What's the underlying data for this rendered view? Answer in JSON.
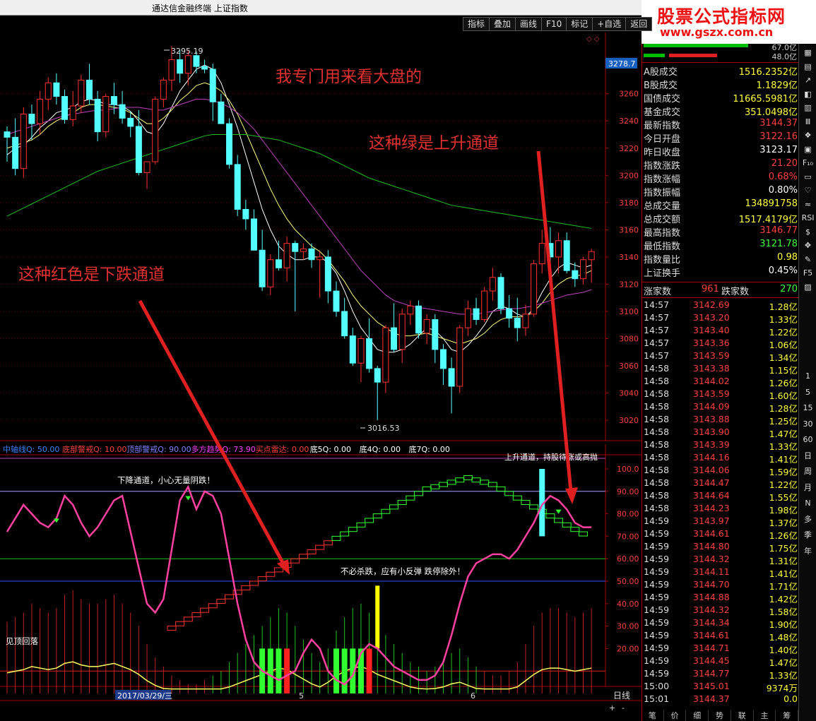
{
  "window": {
    "title": "通达信金融终端    上证指数"
  },
  "watermark": {
    "line1": "股票公式指标网",
    "line2": "www.gszx.com.cn",
    "logo": "G"
  },
  "toolbar": [
    "指标",
    "叠加",
    "画线",
    "F10",
    "标记",
    "+自选",
    "返回"
  ],
  "price_axis": {
    "current_tag": "3278.7",
    "ticks": [
      "3260",
      "3240",
      "3220",
      "3200",
      "3180",
      "3160",
      "3140",
      "3120",
      "3100",
      "3080",
      "3060",
      "3040",
      "3020"
    ]
  },
  "indicator_axis": {
    "ticks": [
      "100.0",
      "90.00",
      "80.00",
      "70.00",
      "60.00",
      "50.00",
      "40.00",
      "30.00",
      "20.00"
    ]
  },
  "indicator_header": [
    {
      "text": "中轴线Q: 50.00",
      "color": "#4080ff"
    },
    {
      "text": "底部警戒Q: 10.00",
      "color": "#ff4040"
    },
    {
      "text": "顶部警戒Q: 90.00",
      "color": "#8080ff"
    },
    {
      "text": "多方趋势Q: 73.90",
      "color": "#ff40ff"
    },
    {
      "text": "买点雷达: 0.00",
      "color": "#ff4040"
    },
    {
      "text": "底5Q: 0.00",
      "color": "#ffffff"
    },
    {
      "text": "底4Q: 0.00",
      "color": "#ffffff"
    },
    {
      "text": "底7Q: 0.00",
      "color": "#ffffff"
    }
  ],
  "annotations": {
    "top": "我专门用来看大盘的",
    "green": "这种绿是上升通道",
    "red": "这种红色是下跌通道",
    "high_label": "3295.19",
    "low_label": "3016.53",
    "down_channel": "下降通道，小心无量阴跌！",
    "no_kill": "不必杀跌，应有小反弹 跌停除外！",
    "top_fall": "见顶回落",
    "up_channel_cut": "上升通道，持股待涨或高抛"
  },
  "date_axis": {
    "date": "2017/03/29/三",
    "m5": "5",
    "m6": "6",
    "period": "日线"
  },
  "chart_data": {
    "type": "candlestick",
    "title": "上证指数",
    "ylim": [
      3005,
      3305
    ],
    "high": 3295.19,
    "low": 3016.53,
    "candles": [
      [
        3232,
        3236,
        3210,
        3228
      ],
      [
        3228,
        3242,
        3200,
        3205
      ],
      [
        3205,
        3250,
        3198,
        3245
      ],
      [
        3245,
        3252,
        3226,
        3238
      ],
      [
        3238,
        3262,
        3230,
        3256
      ],
      [
        3256,
        3272,
        3248,
        3268
      ],
      [
        3268,
        3275,
        3252,
        3258
      ],
      [
        3258,
        3263,
        3238,
        3241
      ],
      [
        3241,
        3262,
        3236,
        3251
      ],
      [
        3251,
        3274,
        3246,
        3270
      ],
      [
        3270,
        3282,
        3252,
        3256
      ],
      [
        3256,
        3262,
        3225,
        3232
      ],
      [
        3232,
        3260,
        3228,
        3258
      ],
      [
        3258,
        3268,
        3245,
        3252
      ],
      [
        3252,
        3262,
        3238,
        3242
      ],
      [
        3242,
        3247,
        3228,
        3236
      ],
      [
        3236,
        3248,
        3200,
        3202
      ],
      [
        3202,
        3210,
        3190,
        3210
      ],
      [
        3210,
        3258,
        3208,
        3256
      ],
      [
        3256,
        3272,
        3250,
        3270
      ],
      [
        3270,
        3295,
        3262,
        3285
      ],
      [
        3285,
        3292,
        3268,
        3275
      ],
      [
        3275,
        3292,
        3266,
        3288
      ],
      [
        3288,
        3291,
        3275,
        3280
      ],
      [
        3280,
        3285,
        3275,
        3278
      ],
      [
        3278,
        3282,
        3240,
        3254
      ],
      [
        3254,
        3260,
        3242,
        3238
      ],
      [
        3238,
        3242,
        3205,
        3208
      ],
      [
        3208,
        3215,
        3170,
        3175
      ],
      [
        3175,
        3182,
        3160,
        3168
      ],
      [
        3168,
        3175,
        3150,
        3145
      ],
      [
        3145,
        3160,
        3115,
        3118
      ],
      [
        3118,
        3142,
        3112,
        3138
      ],
      [
        3138,
        3152,
        3130,
        3132
      ],
      [
        3132,
        3155,
        3122,
        3150
      ],
      [
        3150,
        3152,
        3100,
        3144
      ],
      [
        3144,
        3150,
        3138,
        3146
      ],
      [
        3146,
        3150,
        3132,
        3138
      ],
      [
        3138,
        3144,
        3110,
        3140
      ],
      [
        3140,
        3145,
        3106,
        3115
      ],
      [
        3115,
        3122,
        3096,
        3100
      ],
      [
        3100,
        3110,
        3080,
        3082
      ],
      [
        3082,
        3088,
        3060,
        3062
      ],
      [
        3062,
        3082,
        3048,
        3080
      ],
      [
        3080,
        3095,
        3055,
        3058
      ],
      [
        3058,
        3060,
        3020,
        3048
      ],
      [
        3048,
        3090,
        3040,
        3088
      ],
      [
        3088,
        3106,
        3070,
        3072
      ],
      [
        3072,
        3102,
        3062,
        3098
      ],
      [
        3098,
        3108,
        3090,
        3104
      ],
      [
        3104,
        3108,
        3080,
        3084
      ],
      [
        3084,
        3098,
        3076,
        3094
      ],
      [
        3094,
        3098,
        3062,
        3072
      ],
      [
        3072,
        3076,
        3046,
        3058
      ],
      [
        3058,
        3066,
        3025,
        3045
      ],
      [
        3045,
        3090,
        3040,
        3088
      ],
      [
        3088,
        3108,
        3082,
        3102
      ],
      [
        3102,
        3110,
        3090,
        3094
      ],
      [
        3094,
        3118,
        3092,
        3115
      ],
      [
        3115,
        3132,
        3108,
        3125
      ],
      [
        3125,
        3128,
        3098,
        3102
      ],
      [
        3102,
        3112,
        3088,
        3095
      ],
      [
        3095,
        3110,
        3078,
        3088
      ],
      [
        3088,
        3105,
        3082,
        3098
      ],
      [
        3098,
        3138,
        3096,
        3135
      ],
      [
        3135,
        3160,
        3128,
        3150
      ],
      [
        3150,
        3162,
        3136,
        3140
      ],
      [
        3140,
        3158,
        3128,
        3152
      ],
      [
        3152,
        3158,
        3128,
        3130
      ],
      [
        3130,
        3136,
        3118,
        3124
      ],
      [
        3124,
        3140,
        3120,
        3138
      ],
      [
        3138,
        3146,
        3121,
        3144
      ]
    ],
    "ma_lines": [
      {
        "color": "#ffffff",
        "values": [
          3215,
          3220,
          3222,
          3228,
          3235,
          3240,
          3246,
          3248,
          3250,
          3254,
          3256,
          3255,
          3252,
          3252,
          3251,
          3247,
          3240,
          3232,
          3230,
          3238,
          3250,
          3262,
          3270,
          3278,
          3281,
          3278,
          3268,
          3252,
          3235,
          3215,
          3195,
          3175,
          3160,
          3148,
          3142,
          3138,
          3138,
          3140,
          3140,
          3136,
          3128,
          3115,
          3100,
          3088,
          3080,
          3072,
          3070,
          3070,
          3072,
          3076,
          3082,
          3088,
          3086,
          3080,
          3072,
          3070,
          3075,
          3082,
          3090,
          3100,
          3104,
          3102,
          3098,
          3096,
          3102,
          3114,
          3124,
          3132,
          3136,
          3134,
          3132,
          3134
        ]
      },
      {
        "color": "#ffff80",
        "values": [
          3220,
          3222,
          3224,
          3226,
          3230,
          3236,
          3240,
          3243,
          3246,
          3250,
          3252,
          3252,
          3251,
          3250,
          3249,
          3246,
          3242,
          3238,
          3238,
          3242,
          3248,
          3255,
          3260,
          3266,
          3268,
          3266,
          3262,
          3255,
          3245,
          3232,
          3218,
          3204,
          3190,
          3178,
          3168,
          3160,
          3154,
          3148,
          3144,
          3138,
          3130,
          3122,
          3112,
          3104,
          3098,
          3092,
          3088,
          3084,
          3082,
          3082,
          3083,
          3084,
          3082,
          3080,
          3078,
          3076,
          3078,
          3080,
          3084,
          3090,
          3094,
          3096,
          3096,
          3096,
          3100,
          3106,
          3114,
          3120,
          3124,
          3126,
          3127,
          3130
        ]
      },
      {
        "color": "#c040c0",
        "values": [
          3230,
          3232,
          3234,
          3236,
          3238,
          3240,
          3242,
          3244,
          3245,
          3246,
          3247,
          3248,
          3248,
          3249,
          3250,
          3250,
          3250,
          3249,
          3248,
          3248,
          3250,
          3252,
          3254,
          3256,
          3256,
          3255,
          3253,
          3250,
          3246,
          3240,
          3234,
          3226,
          3218,
          3210,
          3202,
          3194,
          3186,
          3178,
          3170,
          3162,
          3154,
          3146,
          3138,
          3130,
          3124,
          3118,
          3112,
          3108,
          3106,
          3104,
          3103,
          3102,
          3101,
          3100,
          3099,
          3098,
          3098,
          3098,
          3099,
          3100,
          3101,
          3102,
          3102,
          3103,
          3104,
          3106,
          3108,
          3110,
          3112,
          3113,
          3114,
          3116
        ]
      },
      {
        "color": "#20c020",
        "values": [
          3170,
          3173,
          3176,
          3179,
          3182,
          3185,
          3188,
          3191,
          3194,
          3197,
          3200,
          3203,
          3205,
          3207,
          3209,
          3211,
          3213,
          3215,
          3217,
          3219,
          3221,
          3223,
          3225,
          3227,
          3229,
          3230,
          3230,
          3230,
          3230,
          3230,
          3229,
          3228,
          3227,
          3226,
          3224,
          3222,
          3220,
          3218,
          3216,
          3213,
          3210,
          3207,
          3204,
          3201,
          3198,
          3196,
          3194,
          3192,
          3190,
          3188,
          3186,
          3184,
          3182,
          3180,
          3178,
          3177,
          3176,
          3175,
          3174,
          3173,
          3172,
          3171,
          3170,
          3169,
          3168,
          3167,
          3166,
          3165,
          3164,
          3163,
          3162,
          3161
        ]
      }
    ],
    "indicator": {
      "ylim": [
        0,
        100
      ],
      "trend_line": [
        72,
        78,
        84,
        80,
        76,
        74,
        78,
        88,
        84,
        76,
        70,
        74,
        80,
        86,
        88,
        72,
        56,
        40,
        36,
        42,
        64,
        86,
        92,
        82,
        90,
        88,
        80,
        60,
        40,
        24,
        14,
        10,
        8,
        6,
        8,
        10,
        18,
        24,
        20,
        10,
        6,
        4,
        8,
        18,
        22,
        20,
        16,
        12,
        10,
        8,
        6,
        6,
        8,
        14,
        26,
        40,
        52,
        58,
        60,
        62,
        62,
        60,
        64,
        70,
        76,
        84,
        88,
        86,
        82,
        76,
        74,
        74
      ],
      "stair": [
        28,
        30,
        32,
        34,
        36,
        38,
        40,
        42,
        44,
        46,
        48,
        50,
        52,
        54,
        56,
        58,
        60,
        62,
        64,
        66,
        68,
        70,
        72,
        74,
        76,
        78,
        80,
        82,
        84,
        86,
        88,
        90,
        91,
        92,
        93,
        94,
        95,
        94,
        93,
        92,
        90,
        88,
        86,
        84,
        82,
        80,
        78,
        76,
        74,
        72,
        70
      ]
    }
  },
  "quote_panel": {
    "top_bars": {
      "a": "67.0亿",
      "b": "48.0亿"
    },
    "rows": [
      {
        "label": "A股成交",
        "value": "1516.2352亿",
        "color": "#ffff40"
      },
      {
        "label": "B股成交",
        "value": "1.1829亿",
        "color": "#ffff40"
      },
      {
        "label": "国债成交",
        "value": "11665.5981亿",
        "color": "#ffff40"
      },
      {
        "label": "基金成交",
        "value": "351.0498亿",
        "color": "#ffff40"
      },
      {
        "label": "最新指数",
        "value": "3144.37",
        "color": "#ff4040"
      },
      {
        "label": "今日开盘",
        "value": "3122.16",
        "color": "#ff4040"
      },
      {
        "label": "昨日收盘",
        "value": "3123.17",
        "color": "#ffffff"
      },
      {
        "label": "指数涨跌",
        "value": "21.20",
        "color": "#ff4040"
      },
      {
        "label": "指数涨幅",
        "value": "0.68%",
        "color": "#ff4040"
      },
      {
        "label": "指数振幅",
        "value": "0.80%",
        "color": "#ffffff"
      },
      {
        "label": "总成交量",
        "value": "134891758",
        "color": "#ffff40"
      },
      {
        "label": "总成交额",
        "value": "1517.4179亿",
        "color": "#ffff40"
      },
      {
        "label": "最高指数",
        "value": "3146.77",
        "color": "#ff4040"
      },
      {
        "label": "最低指数",
        "value": "3121.78",
        "color": "#40ff40"
      },
      {
        "label": "指数量比",
        "value": "0.98",
        "color": "#ffff40"
      },
      {
        "label": "上证换手",
        "value": "0.45%",
        "color": "#ffffff"
      }
    ],
    "advance": {
      "up_label": "涨家数",
      "up": "961",
      "down_label": "跌家数",
      "down": "270"
    },
    "ticks": [
      {
        "t": "14:57",
        "p": "3142.69",
        "v": "1.28亿"
      },
      {
        "t": "14:57",
        "p": "3143.20",
        "v": "1.33亿"
      },
      {
        "t": "14:57",
        "p": "3143.40",
        "v": "1.22亿"
      },
      {
        "t": "14:57",
        "p": "3143.36",
        "v": "1.06亿"
      },
      {
        "t": "14:57",
        "p": "3143.59",
        "v": "1.34亿"
      },
      {
        "t": "14:58",
        "p": "3143.38",
        "v": "1.15亿"
      },
      {
        "t": "14:58",
        "p": "3144.02",
        "v": "1.26亿"
      },
      {
        "t": "14:58",
        "p": "3143.59",
        "v": "1.60亿"
      },
      {
        "t": "14:58",
        "p": "3144.09",
        "v": "1.28亿"
      },
      {
        "t": "14:58",
        "p": "3143.88",
        "v": "1.25亿"
      },
      {
        "t": "14:58",
        "p": "3143.90",
        "v": "1.47亿"
      },
      {
        "t": "14:58",
        "p": "3143.39",
        "v": "1.33亿"
      },
      {
        "t": "14:58",
        "p": "3144.16",
        "v": "1.41亿"
      },
      {
        "t": "14:58",
        "p": "3144.06",
        "v": "1.59亿"
      },
      {
        "t": "14:58",
        "p": "3144.47",
        "v": "1.22亿"
      },
      {
        "t": "14:58",
        "p": "3144.64",
        "v": "1.55亿"
      },
      {
        "t": "14:58",
        "p": "3144.23",
        "v": "1.98亿"
      },
      {
        "t": "14:59",
        "p": "3143.97",
        "v": "1.37亿"
      },
      {
        "t": "14:59",
        "p": "3144.61",
        "v": "1.26亿"
      },
      {
        "t": "14:59",
        "p": "3144.80",
        "v": "1.75亿"
      },
      {
        "t": "14:59",
        "p": "3144.32",
        "v": "1.31亿"
      },
      {
        "t": "14:59",
        "p": "3144.11",
        "v": "1.41亿"
      },
      {
        "t": "14:59",
        "p": "3144.70",
        "v": "1.71亿"
      },
      {
        "t": "14:59",
        "p": "3144.88",
        "v": "1.42亿"
      },
      {
        "t": "14:59",
        "p": "3144.32",
        "v": "1.58亿"
      },
      {
        "t": "14:59",
        "p": "3144.34",
        "v": "1.90亿"
      },
      {
        "t": "14:59",
        "p": "3144.61",
        "v": "1.48亿"
      },
      {
        "t": "14:59",
        "p": "3144.71",
        "v": "1.40亿"
      },
      {
        "t": "14:59",
        "p": "3144.45",
        "v": "1.47亿"
      },
      {
        "t": "14:59",
        "p": "3144.77",
        "v": "1.33亿"
      },
      {
        "t": "15:00",
        "p": "3145.01",
        "v": "9374万"
      },
      {
        "t": "15:01",
        "p": "3144.37",
        "v": "0.0"
      }
    ]
  },
  "sidebar": [
    "1",
    "5",
    "15",
    "30",
    "60",
    "日",
    "周",
    "月",
    "N",
    "多",
    "季",
    "年"
  ],
  "bottom_tabs": [
    "笔",
    "价",
    "细",
    "势",
    "联",
    "主",
    "筹"
  ]
}
